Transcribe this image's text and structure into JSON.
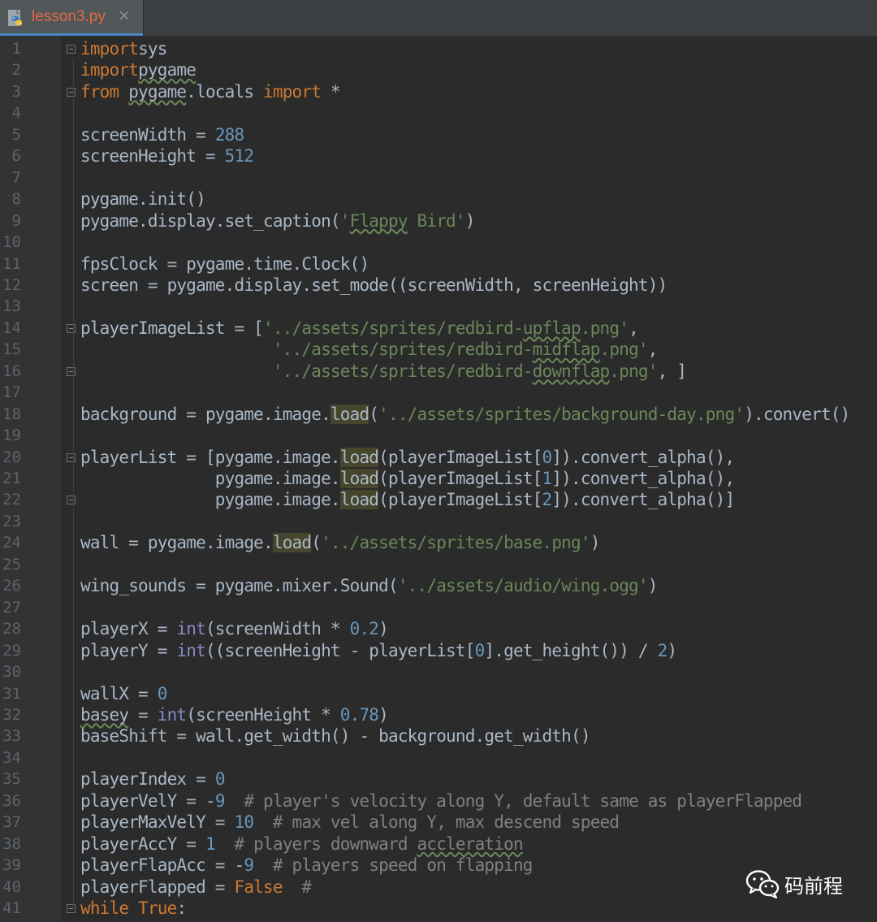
{
  "tab": {
    "filename": "lesson3.py",
    "close_glyph": "×",
    "icon": "python-file-icon",
    "label_color": "#e06b45"
  },
  "editor": {
    "language": "python",
    "theme": "dark",
    "colors": {
      "background": "#2b2b2b",
      "keyword": "#cc7832",
      "string": "#6a8759",
      "number": "#6897bb",
      "builtin": "#8888c6",
      "comment": "#808080",
      "text": "#a9b7c6"
    },
    "line_numbers": [
      "1",
      "2",
      "3",
      "4",
      "5",
      "6",
      "7",
      "8",
      "9",
      "10",
      "11",
      "12",
      "13",
      "14",
      "15",
      "16",
      "17",
      "18",
      "19",
      "20",
      "21",
      "22",
      "23",
      "24",
      "25",
      "26",
      "27",
      "28",
      "29",
      "30",
      "31",
      "32",
      "33",
      "34",
      "35",
      "36",
      "37",
      "38",
      "39",
      "40",
      "41"
    ],
    "lines": [
      [
        [
          "kw",
          "import"
        ],
        [
          "",
          "sys"
        ]
      ],
      [
        [
          "kw",
          "import"
        ],
        [
          "sq",
          "pygame"
        ]
      ],
      [
        [
          "kw",
          "from "
        ],
        [
          "sq",
          "pygame"
        ],
        [
          "",
          ".locals "
        ],
        [
          "kw",
          "import"
        ],
        [
          "",
          " *"
        ]
      ],
      [],
      [
        [
          "",
          "screenWidth = "
        ],
        [
          "num",
          "288"
        ]
      ],
      [
        [
          "",
          "screenHeight = "
        ],
        [
          "num",
          "512"
        ]
      ],
      [],
      [
        [
          "",
          "pygame.init()"
        ]
      ],
      [
        [
          "",
          "pygame.display.set_caption("
        ],
        [
          "str",
          "'"
        ],
        [
          "str sq",
          "Flappy"
        ],
        [
          "str",
          " Bird'"
        ],
        [
          "",
          ")"
        ]
      ],
      [],
      [
        [
          "",
          "fpsClock = pygame.time.Clock()"
        ]
      ],
      [
        [
          "",
          "screen = pygame.display.set_mode((screenWidth, screenHeight))"
        ]
      ],
      [],
      [
        [
          "",
          "playerImageList = ["
        ],
        [
          "str",
          "'../assets/sprites/redbird-"
        ],
        [
          "str sq",
          "upflap"
        ],
        [
          "str",
          ".png'"
        ],
        [
          "",
          ","
        ]
      ],
      [
        [
          "",
          "                    "
        ],
        [
          "str",
          "'../assets/sprites/redbird-"
        ],
        [
          "str sq",
          "midflap"
        ],
        [
          "str",
          ".png'"
        ],
        [
          "",
          ","
        ]
      ],
      [
        [
          "",
          "                    "
        ],
        [
          "str",
          "'../assets/sprites/redbird-"
        ],
        [
          "str sq",
          "downflap"
        ],
        [
          "str",
          ".png'"
        ],
        [
          "",
          ", ]"
        ]
      ],
      [],
      [
        [
          "",
          "background = pygame.image."
        ],
        [
          "hl",
          "load"
        ],
        [
          "",
          "("
        ],
        [
          "str",
          "'../assets/sprites/background-day.png'"
        ],
        [
          "",
          ").convert()"
        ]
      ],
      [],
      [
        [
          "",
          "playerList = [pygame.image."
        ],
        [
          "hl",
          "load"
        ],
        [
          "",
          "(playerImageList["
        ],
        [
          "num",
          "0"
        ],
        [
          "",
          "]).convert_alpha(),"
        ]
      ],
      [
        [
          "",
          "              pygame.image."
        ],
        [
          "hl",
          "load"
        ],
        [
          "",
          "(playerImageList["
        ],
        [
          "num",
          "1"
        ],
        [
          "",
          "]).convert_alpha(),"
        ]
      ],
      [
        [
          "",
          "              pygame.image."
        ],
        [
          "hl",
          "load"
        ],
        [
          "",
          "(playerImageList["
        ],
        [
          "num",
          "2"
        ],
        [
          "",
          "]).convert_alpha()]"
        ]
      ],
      [],
      [
        [
          "",
          "wall = pygame.image."
        ],
        [
          "hl",
          "load"
        ],
        [
          "",
          "("
        ],
        [
          "str",
          "'../assets/sprites/base.png'"
        ],
        [
          "",
          ")"
        ]
      ],
      [],
      [
        [
          "",
          "wing_sounds = pygame.mixer.Sound("
        ],
        [
          "str",
          "'../assets/audio/wing.ogg'"
        ],
        [
          "",
          ")"
        ]
      ],
      [],
      [
        [
          "",
          "playerX = "
        ],
        [
          "bi",
          "int"
        ],
        [
          "",
          "(screenWidth * "
        ],
        [
          "num",
          "0.2"
        ],
        [
          "",
          ")"
        ]
      ],
      [
        [
          "",
          "playerY = "
        ],
        [
          "bi",
          "int"
        ],
        [
          "",
          "((screenHeight - playerList["
        ],
        [
          "num",
          "0"
        ],
        [
          "",
          "].get_height()) / "
        ],
        [
          "num",
          "2"
        ],
        [
          "",
          ")"
        ]
      ],
      [],
      [
        [
          "",
          "wallX = "
        ],
        [
          "num",
          "0"
        ]
      ],
      [
        [
          "sq",
          "basey"
        ],
        [
          "",
          " = "
        ],
        [
          "bi",
          "int"
        ],
        [
          "",
          "(screenHeight * "
        ],
        [
          "num",
          "0.78"
        ],
        [
          "",
          ")"
        ]
      ],
      [
        [
          "",
          "baseShift = wall.get_width() - background.get_width()"
        ]
      ],
      [],
      [
        [
          "",
          "playerIndex = "
        ],
        [
          "num",
          "0"
        ]
      ],
      [
        [
          "",
          "playerVelY = -"
        ],
        [
          "num",
          "9"
        ],
        [
          "",
          "  "
        ],
        [
          "cm",
          "# player's velocity along Y, default same as playerFlapped"
        ]
      ],
      [
        [
          "",
          "playerMaxVelY = "
        ],
        [
          "num",
          "10"
        ],
        [
          "",
          "  "
        ],
        [
          "cm",
          "# max vel along Y, max descend speed"
        ]
      ],
      [
        [
          "",
          "playerAccY = "
        ],
        [
          "num",
          "1"
        ],
        [
          "",
          "  "
        ],
        [
          "cm",
          "# players downward "
        ],
        [
          "cm sq",
          "accleration"
        ]
      ],
      [
        [
          "",
          "playerFlapAcc = -"
        ],
        [
          "num",
          "9"
        ],
        [
          "",
          "  "
        ],
        [
          "cm",
          "# players speed on flapping"
        ]
      ],
      [
        [
          "",
          "playerFlapped = "
        ],
        [
          "kw",
          "False"
        ],
        [
          "",
          "  "
        ],
        [
          "cm",
          "#"
        ]
      ],
      [
        [
          "kw",
          "while"
        ],
        [
          "",
          " "
        ],
        [
          "kw",
          "True"
        ],
        [
          "",
          ":"
        ]
      ]
    ]
  },
  "watermark": {
    "label": "码前程",
    "icon": "wechat-icon"
  }
}
